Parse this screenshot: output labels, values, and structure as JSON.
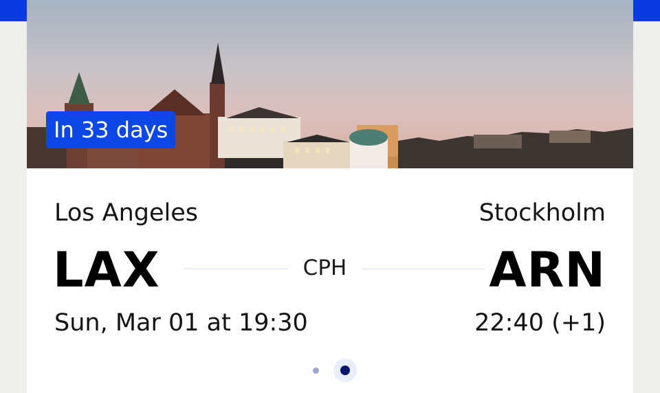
{
  "colors": {
    "accent": "#0b3be0",
    "badge": "#0c47e6",
    "active_dot": "#07166d"
  },
  "hero": {
    "image": "stockholm-skyline-photo",
    "badge_text": "In 33 days"
  },
  "flight": {
    "origin": {
      "city": "Los Angeles",
      "code": "LAX",
      "departure": "Sun, Mar 01 at 19:30"
    },
    "via": "CPH",
    "destination": {
      "city": "Stockholm",
      "code": "ARN",
      "arrival": "22:40 (+1)"
    }
  },
  "pagination": {
    "count": 2,
    "active_index": 1
  }
}
